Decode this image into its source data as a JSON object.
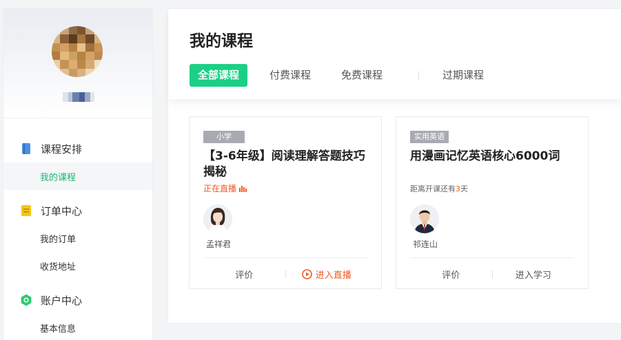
{
  "sidebar": {
    "groups": [
      {
        "label": "课程安排",
        "icon": "book-icon",
        "color": "#4a90e2",
        "items": [
          {
            "label": "我的课程",
            "active": true
          }
        ]
      },
      {
        "label": "订单中心",
        "icon": "note-icon",
        "color": "#f5c518",
        "items": [
          {
            "label": "我的订单"
          },
          {
            "label": "收货地址"
          }
        ]
      },
      {
        "label": "账户中心",
        "icon": "gear-icon",
        "color": "#2ecc71",
        "items": [
          {
            "label": "基本信息"
          }
        ]
      }
    ]
  },
  "main": {
    "title": "我的课程",
    "tabs": [
      {
        "label": "全部课程",
        "active": true
      },
      {
        "label": "付费课程"
      },
      {
        "label": "免费课程"
      },
      {
        "label": "过期课程"
      }
    ],
    "courses": [
      {
        "tag": "小学",
        "title": "【3-6年级】阅读理解答题技巧揭秘",
        "status": "正在直播",
        "teacher": "孟祥君",
        "review_label": "评价",
        "action_label": "进入直播"
      },
      {
        "tag": "实用英语",
        "title": "用漫画记忆英语核心6000词",
        "countdown_prefix": "距离开课还有",
        "countdown_days": "3",
        "countdown_suffix": "天",
        "teacher": "祁连山",
        "review_label": "评价",
        "action_label": "进入学习"
      }
    ]
  },
  "colors": {
    "accent": "#1ccf86",
    "live": "#f05a23",
    "active_nav_text": "#1bb674"
  }
}
